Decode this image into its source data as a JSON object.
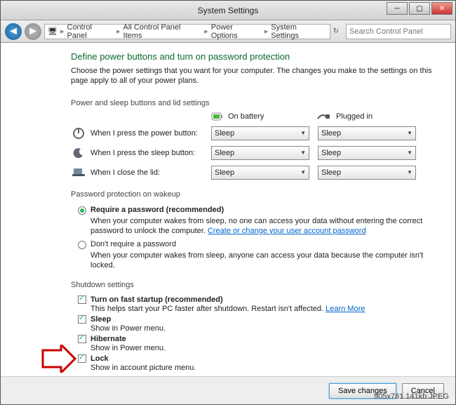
{
  "titlebar": {
    "title": "System Settings"
  },
  "breadcrumb": {
    "items": [
      "Control Panel",
      "All Control Panel Items",
      "Power Options",
      "System Settings"
    ]
  },
  "search": {
    "placeholder": "Search Control Panel"
  },
  "page": {
    "title": "Define power buttons and turn on password protection",
    "desc": "Choose the power settings that you want for your computer. The changes you make to the settings on this page apply to all of your power plans."
  },
  "section1": {
    "label": "Power and sleep buttons and lid settings",
    "col_battery": "On battery",
    "col_plugged": "Plugged in",
    "rows": {
      "power": {
        "label": "When I press the power button:",
        "batt": "Sleep",
        "plug": "Sleep"
      },
      "sleep": {
        "label": "When I press the sleep button:",
        "batt": "Sleep",
        "plug": "Sleep"
      },
      "lid": {
        "label": "When I close the lid:",
        "batt": "Sleep",
        "plug": "Sleep"
      }
    }
  },
  "section2": {
    "label": "Password protection on wakeup",
    "opt_req": {
      "label": "Require a password (recommended)",
      "desc": "When your computer wakes from sleep, no one can access your data without entering the correct password to unlock the computer. ",
      "link": "Create or change your user account password"
    },
    "opt_noreq": {
      "label": "Don't require a password",
      "desc": "When your computer wakes from sleep, anyone can access your data because the computer isn't locked."
    }
  },
  "section3": {
    "label": "Shutdown settings",
    "fast": {
      "label": "Turn on fast startup (recommended)",
      "desc": "This helps start your PC faster after shutdown. Restart isn't affected. ",
      "link": "Learn More"
    },
    "sleep": {
      "label": "Sleep",
      "desc": "Show in Power menu."
    },
    "hib": {
      "label": "Hibernate",
      "desc": "Show in Power menu."
    },
    "lock": {
      "label": "Lock",
      "desc": "Show in account picture menu."
    }
  },
  "footer": {
    "save": "Save changes",
    "cancel": "Cancel"
  },
  "meta": "905x781  141kb  JPEG"
}
